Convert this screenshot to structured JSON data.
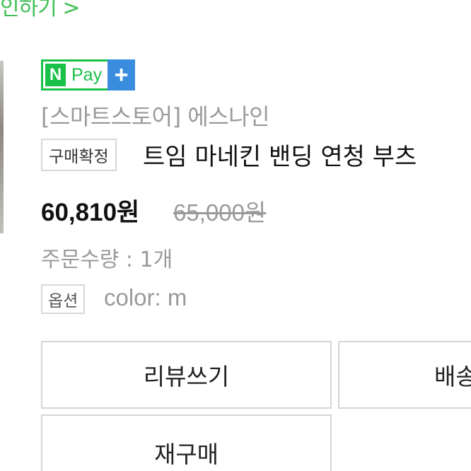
{
  "top_link": "인하기 >",
  "npay": {
    "n_letter": "N",
    "label": "Pay",
    "plus": "+"
  },
  "order": {
    "store": "[스마트스토어] 에스나인",
    "status_badge": "구매확정",
    "product_title": "트임 마네킨 밴딩 연청 부츠",
    "price": "60,810원",
    "original_price": "65,000원",
    "quantity": "주문수량 : 1개",
    "option_badge": "옵션",
    "option_value": "color: m"
  },
  "buttons": {
    "review": "리뷰쓰기",
    "shipping": "배송",
    "rebuy": "재구매"
  },
  "colors": {
    "npay_green": "#19c148",
    "npay_blue": "#3a8dde",
    "link_green": "#3fbf53"
  }
}
